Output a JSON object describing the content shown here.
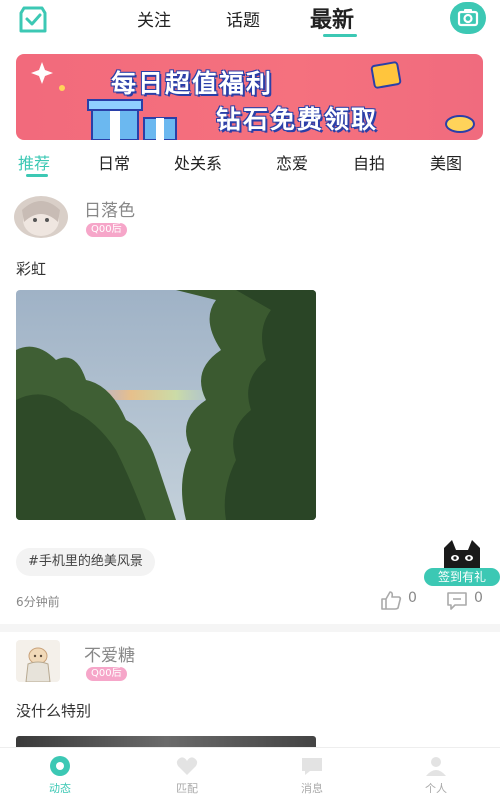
{
  "colors": {
    "accent": "#3cc8b4",
    "badge_pink": "#f6a6c9",
    "banner": "#f26a7c"
  },
  "topnav": {
    "tabs": [
      {
        "label": "关注"
      },
      {
        "label": "话题"
      },
      {
        "label": "最新",
        "active": true
      }
    ],
    "left_icon": "check-bag-icon",
    "right_icon": "camera-icon"
  },
  "banner": {
    "line1": "每日超值福利",
    "line2": "钻石免费领取"
  },
  "categories": [
    {
      "label": "推荐",
      "active": true
    },
    {
      "label": "日常"
    },
    {
      "label": "处关系"
    },
    {
      "label": "恋爱"
    },
    {
      "label": "自拍"
    },
    {
      "label": "美图"
    }
  ],
  "posts": [
    {
      "username": "日落色",
      "age_badge": "Q00后",
      "text": "彩虹",
      "topic": "#手机里的绝美风景",
      "time": "6分钟前",
      "likes": "0",
      "comments": "0"
    },
    {
      "username": "不爱糖",
      "age_badge": "Q00后",
      "text": "没什么特别"
    }
  ],
  "floating": {
    "label": "签到有礼",
    "icon": "black-cat-icon"
  },
  "bottomnav": [
    {
      "label": "动态",
      "icon": "dynamic-icon",
      "active": true
    },
    {
      "label": "匹配",
      "icon": "match-icon"
    },
    {
      "label": "消息",
      "icon": "message-icon"
    },
    {
      "label": "个人",
      "icon": "profile-icon"
    }
  ]
}
